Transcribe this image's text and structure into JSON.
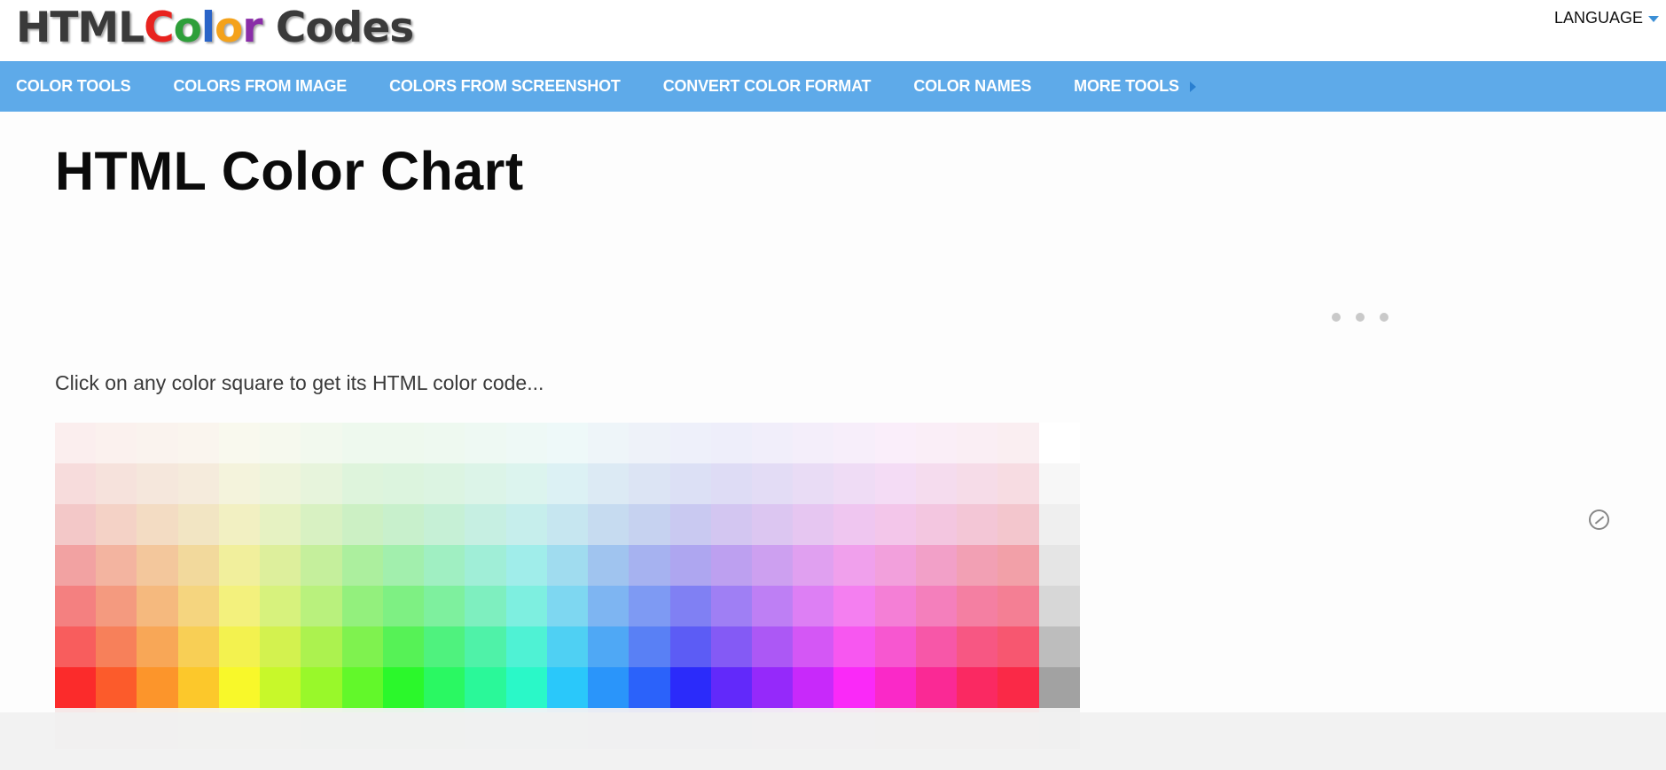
{
  "header": {
    "logo_letters": [
      {
        "ch": "HTML ",
        "color": "#3a3a3a"
      },
      {
        "ch": "C",
        "color": "#e8231f"
      },
      {
        "ch": "o",
        "color": "#2e9f3a"
      },
      {
        "ch": "l",
        "color": "#2a64c8"
      },
      {
        "ch": "o",
        "color": "#f4a21b"
      },
      {
        "ch": "r",
        "color": "#8a2da8"
      },
      {
        "ch": " Codes",
        "color": "#3a3a3a"
      }
    ],
    "language_label": "LANGUAGE"
  },
  "nav": {
    "items": [
      {
        "label": "COLOR TOOLS"
      },
      {
        "label": "COLORS FROM IMAGE"
      },
      {
        "label": "COLORS FROM SCREENSHOT"
      },
      {
        "label": "CONVERT COLOR FORMAT"
      },
      {
        "label": "COLOR NAMES"
      },
      {
        "label": "MORE TOOLS"
      }
    ]
  },
  "main": {
    "title": "HTML Color Chart",
    "intro": "Click on any color square to get its HTML color code..."
  },
  "color_chart": {
    "rows": [
      [
        "#fbeeee",
        "#fbf1ee",
        "#faf3ee",
        "#faf5ee",
        "#f9f9ee",
        "#f6f9ee",
        "#f2f9ee",
        "#eef9ee",
        "#eef9ee",
        "#eef9f0",
        "#eef9f3",
        "#eef9f6",
        "#eef9f9",
        "#eef5f9",
        "#eef2f9",
        "#eef0fa",
        "#eeeefa",
        "#f1eefa",
        "#f4eefa",
        "#f7eefa",
        "#faeefa",
        "#faeef7",
        "#faeef4",
        "#faeef1",
        "#ffffff"
      ],
      [
        "#f7dcdc",
        "#f6e2dc",
        "#f5e7dc",
        "#f5ebdc",
        "#f4f3dc",
        "#eef4dc",
        "#e7f4dc",
        "#def4dc",
        "#dcf4de",
        "#dcf4e2",
        "#dcf4e8",
        "#dcf4ee",
        "#dcf1f4",
        "#dceaf4",
        "#dce4f4",
        "#dce0f5",
        "#dedcf5",
        "#e3dcf5",
        "#e9dcf5",
        "#efdcf5",
        "#f4dcf5",
        "#f5dcee",
        "#f6dce8",
        "#f7dce2",
        "#f7f7f7"
      ],
      [
        "#f3c8c8",
        "#f4d2c6",
        "#f3dcc3",
        "#f2e5c3",
        "#f2f0c2",
        "#e6f2c2",
        "#d8f1c2",
        "#ccf0c4",
        "#c8f0cc",
        "#c6f0d6",
        "#c6efe2",
        "#c6eeec",
        "#c6e6f0",
        "#c6dbf0",
        "#c6d2f0",
        "#c9c9f1",
        "#d3c6f1",
        "#dcc6f1",
        "#e6c6f1",
        "#efc6f0",
        "#f3c6ea",
        "#f3c6e0",
        "#f3c6d6",
        "#f3c6cd",
        "#efefef"
      ],
      [
        "#f2a2a2",
        "#f3b4a0",
        "#f3c79c",
        "#f2d99c",
        "#f1ef9c",
        "#ddef9c",
        "#c5ef9c",
        "#acef9e",
        "#a2efad",
        "#a0efc2",
        "#a0eed7",
        "#a0edea",
        "#a0dcef",
        "#a0c4ef",
        "#a6b2f0",
        "#aea6f0",
        "#bda0f0",
        "#cda0f0",
        "#e0a0f0",
        "#f0a0ec",
        "#f2a0dc",
        "#f2a0c8",
        "#f2a0b4",
        "#f2a0a8",
        "#e5e5e5"
      ],
      [
        "#f48080",
        "#f49a7f",
        "#f5b97e",
        "#f5d57f",
        "#f3f17d",
        "#d7f27d",
        "#b9f17d",
        "#93f07d",
        "#7ef083",
        "#7ef09e",
        "#7eefbf",
        "#7eefe0",
        "#7ed7f1",
        "#7eb5f2",
        "#7e9af3",
        "#8080f3",
        "#9f7ff4",
        "#be7ff4",
        "#dd7ff4",
        "#f47ff0",
        "#f47fd6",
        "#f47fbc",
        "#f47fa2",
        "#f47f94",
        "#d7d7d7"
      ],
      [
        "#f85d5d",
        "#f7805a",
        "#f8a757",
        "#f8cf55",
        "#f3f24f",
        "#d3f24f",
        "#acf24f",
        "#7ff24f",
        "#56f256",
        "#4ff27e",
        "#4ff2a8",
        "#4ff2d4",
        "#4fd0f3",
        "#4fa8f5",
        "#5980f5",
        "#5c5cf5",
        "#845af5",
        "#ac58f5",
        "#d457f5",
        "#f757f0",
        "#f757d0",
        "#f757a8",
        "#f75783",
        "#f75770",
        "#bdbdbd"
      ],
      [
        "#fb2b2b",
        "#fc5b2b",
        "#fc952b",
        "#fcc82b",
        "#f8f82a",
        "#c8f82a",
        "#99f82a",
        "#62f82a",
        "#2bf82b",
        "#2af862",
        "#2af899",
        "#2af8c8",
        "#2ac8fa",
        "#2a95fa",
        "#2b62fa",
        "#2b2bfa",
        "#6229fa",
        "#9529fa",
        "#c829fa",
        "#fa29f8",
        "#fa29c8",
        "#fa2995",
        "#fa2962",
        "#fa2947",
        "#a2a2a2"
      ],
      [
        "#f6e8e8",
        "#f6ece8",
        "#f6efe8",
        "#f6f2e8",
        "#f5f5e8",
        "#f2f5e8",
        "#eef5e8",
        "#eaf5e8",
        "#e8f5ea",
        "#e8f5ee",
        "#e8f5f2",
        "#e8f4f5",
        "#e8f0f5",
        "#e8ecf5",
        "#e8e9f5",
        "#eae8f5",
        "#ede8f5",
        "#f1e8f5",
        "#f4e8f5",
        "#f5e8f2",
        "#f5e8ee",
        "#f5e8ea",
        "#f5e8e8",
        "#f5e8e8",
        "#efefef"
      ]
    ]
  }
}
